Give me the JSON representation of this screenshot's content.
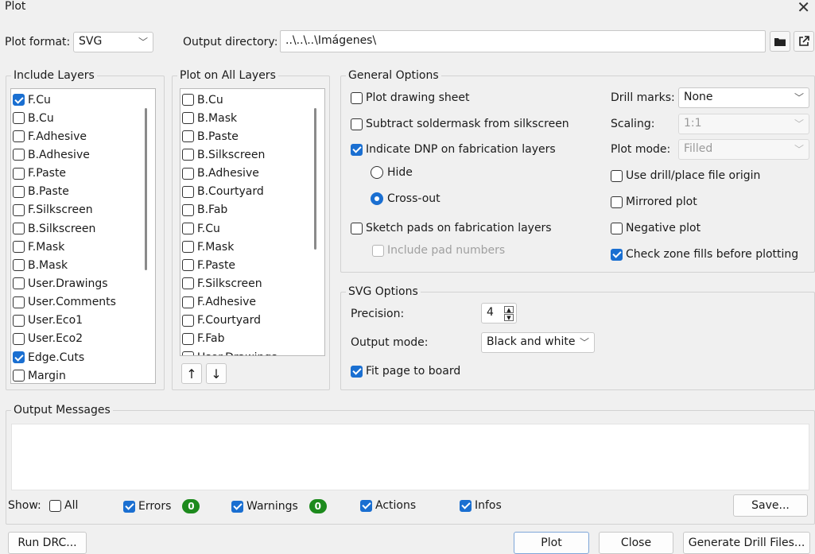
{
  "window": {
    "title": "Plot"
  },
  "header": {
    "plot_format_label": "Plot format:",
    "plot_format_value": "SVG",
    "output_dir_label": "Output directory:",
    "output_dir_value": "..\\..\\..\\Imágenes\\"
  },
  "include_layers": {
    "title": "Include Layers",
    "items": [
      {
        "label": "F.Cu",
        "checked": true
      },
      {
        "label": "B.Cu",
        "checked": false
      },
      {
        "label": "F.Adhesive",
        "checked": false
      },
      {
        "label": "B.Adhesive",
        "checked": false
      },
      {
        "label": "F.Paste",
        "checked": false
      },
      {
        "label": "B.Paste",
        "checked": false
      },
      {
        "label": "F.Silkscreen",
        "checked": false
      },
      {
        "label": "B.Silkscreen",
        "checked": false
      },
      {
        "label": "F.Mask",
        "checked": false
      },
      {
        "label": "B.Mask",
        "checked": false
      },
      {
        "label": "User.Drawings",
        "checked": false
      },
      {
        "label": "User.Comments",
        "checked": false
      },
      {
        "label": "User.Eco1",
        "checked": false
      },
      {
        "label": "User.Eco2",
        "checked": false
      },
      {
        "label": "Edge.Cuts",
        "checked": true
      },
      {
        "label": "Margin",
        "checked": false
      }
    ]
  },
  "plot_all_layers": {
    "title": "Plot on All Layers",
    "items": [
      {
        "label": "B.Cu",
        "checked": false
      },
      {
        "label": "B.Mask",
        "checked": false
      },
      {
        "label": "B.Paste",
        "checked": false
      },
      {
        "label": "B.Silkscreen",
        "checked": false
      },
      {
        "label": "B.Adhesive",
        "checked": false
      },
      {
        "label": "B.Courtyard",
        "checked": false
      },
      {
        "label": "B.Fab",
        "checked": false
      },
      {
        "label": "F.Cu",
        "checked": false
      },
      {
        "label": "F.Mask",
        "checked": false
      },
      {
        "label": "F.Paste",
        "checked": false
      },
      {
        "label": "F.Silkscreen",
        "checked": false
      },
      {
        "label": "F.Adhesive",
        "checked": false
      },
      {
        "label": "F.Courtyard",
        "checked": false
      },
      {
        "label": "F.Fab",
        "checked": false
      },
      {
        "label": "User.Drawings",
        "checked": false
      }
    ],
    "move_up": "↑",
    "move_down": "↓"
  },
  "general": {
    "title": "General Options",
    "plot_drawing_sheet": "Plot drawing sheet",
    "subtract_soldermask": "Subtract soldermask from silkscreen",
    "indicate_dnp": "Indicate DNP on fabrication layers",
    "hide": "Hide",
    "cross_out": "Cross-out",
    "sketch_pads": "Sketch pads on fabrication layers",
    "include_pad_numbers": "Include pad numbers",
    "drill_marks_label": "Drill marks:",
    "drill_marks_value": "None",
    "scaling_label": "Scaling:",
    "scaling_value": "1:1",
    "plot_mode_label": "Plot mode:",
    "plot_mode_value": "Filled",
    "use_drill_origin": "Use drill/place file origin",
    "mirrored": "Mirrored plot",
    "negative": "Negative plot",
    "check_zone_fills": "Check zone fills before plotting"
  },
  "svg": {
    "title": "SVG Options",
    "precision_label": "Precision:",
    "precision_value": "4",
    "output_mode_label": "Output mode:",
    "output_mode_value": "Black and white",
    "fit_page": "Fit page to board"
  },
  "messages": {
    "title": "Output Messages",
    "show_label": "Show:",
    "all": "All",
    "errors": "Errors",
    "errors_count": "0",
    "warnings": "Warnings",
    "warnings_count": "0",
    "actions": "Actions",
    "infos": "Infos",
    "save": "Save..."
  },
  "footer": {
    "run_drc": "Run DRC...",
    "plot": "Plot",
    "close": "Close",
    "generate_drill": "Generate Drill Files..."
  },
  "colors": {
    "accent": "#1a6fd1",
    "badge": "#1d8a1d"
  }
}
